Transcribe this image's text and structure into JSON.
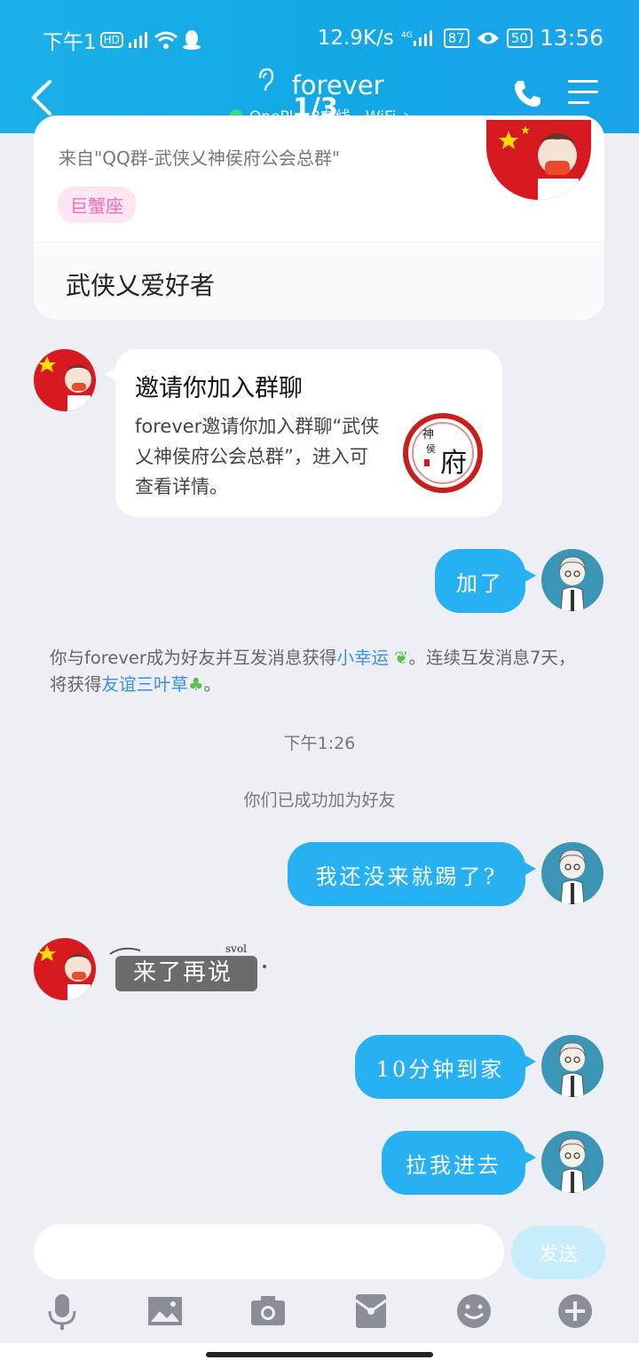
{
  "status_bar": {
    "left_text": "下午1",
    "net_speed": "12.9K/s",
    "battery_1": "87",
    "battery_2": "50",
    "time": "13:56"
  },
  "header": {
    "title": "forever",
    "subtitle": "OnePlus8在线 - WiFi",
    "subtitle_arrow": "›",
    "page_indicator": "1/3"
  },
  "profile_card": {
    "source": "来自\"QQ群-武侠乂神侯府公会总群\"",
    "zodiac_tag": "巨蟹座",
    "hobby": "武侠乂爱好者"
  },
  "invite_card": {
    "title": "邀请你加入群聊",
    "body": "forever邀请你加入群聊“武侠乂神侯府公会总群”，进入可查看详情。",
    "logo_chars": [
      "神",
      "侯",
      "府"
    ]
  },
  "messages": [
    {
      "text": "加了"
    },
    {
      "text": "我还没来就踢了?"
    },
    {
      "text": "10分钟到家"
    },
    {
      "text": "拉我进去"
    }
  ],
  "sticker": {
    "text": "来了再说",
    "tag": "svol"
  },
  "system_notice": {
    "part1": "你与forever成为好友并互发消息获得",
    "link1": "小幸运",
    "part2": "。连续互发消息7天，将获得",
    "link2": "友谊三叶草",
    "part3": "。"
  },
  "timestamp": "下午1:26",
  "friend_notice": "你们已成功加为好友",
  "input_bar": {
    "placeholder": "",
    "send_label": "发送"
  },
  "colors": {
    "header": "#14aae6",
    "bubble": "#27b1f2",
    "link": "#3a8ee6",
    "tag_bg": "#fde5f3"
  }
}
